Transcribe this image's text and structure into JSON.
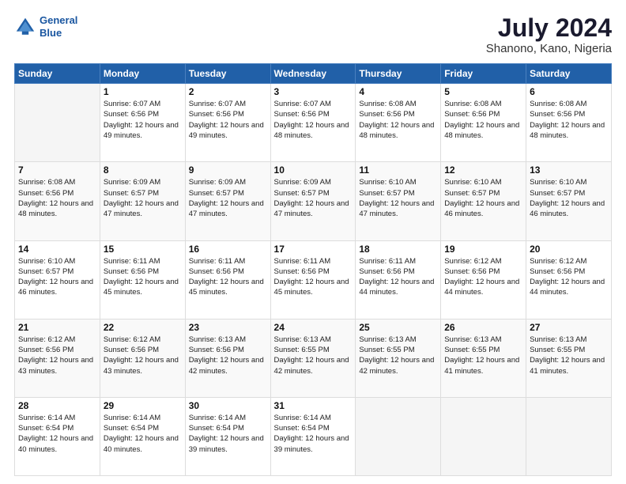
{
  "header": {
    "logo_line1": "General",
    "logo_line2": "Blue",
    "month": "July 2024",
    "location": "Shanono, Kano, Nigeria"
  },
  "days_of_week": [
    "Sunday",
    "Monday",
    "Tuesday",
    "Wednesday",
    "Thursday",
    "Friday",
    "Saturday"
  ],
  "weeks": [
    [
      {
        "day": "",
        "info": ""
      },
      {
        "day": "1",
        "info": "Sunrise: 6:07 AM\nSunset: 6:56 PM\nDaylight: 12 hours\nand 49 minutes."
      },
      {
        "day": "2",
        "info": "Sunrise: 6:07 AM\nSunset: 6:56 PM\nDaylight: 12 hours\nand 49 minutes."
      },
      {
        "day": "3",
        "info": "Sunrise: 6:07 AM\nSunset: 6:56 PM\nDaylight: 12 hours\nand 48 minutes."
      },
      {
        "day": "4",
        "info": "Sunrise: 6:08 AM\nSunset: 6:56 PM\nDaylight: 12 hours\nand 48 minutes."
      },
      {
        "day": "5",
        "info": "Sunrise: 6:08 AM\nSunset: 6:56 PM\nDaylight: 12 hours\nand 48 minutes."
      },
      {
        "day": "6",
        "info": "Sunrise: 6:08 AM\nSunset: 6:56 PM\nDaylight: 12 hours\nand 48 minutes."
      }
    ],
    [
      {
        "day": "7",
        "info": "Sunrise: 6:08 AM\nSunset: 6:56 PM\nDaylight: 12 hours\nand 48 minutes."
      },
      {
        "day": "8",
        "info": "Sunrise: 6:09 AM\nSunset: 6:57 PM\nDaylight: 12 hours\nand 47 minutes."
      },
      {
        "day": "9",
        "info": "Sunrise: 6:09 AM\nSunset: 6:57 PM\nDaylight: 12 hours\nand 47 minutes."
      },
      {
        "day": "10",
        "info": "Sunrise: 6:09 AM\nSunset: 6:57 PM\nDaylight: 12 hours\nand 47 minutes."
      },
      {
        "day": "11",
        "info": "Sunrise: 6:10 AM\nSunset: 6:57 PM\nDaylight: 12 hours\nand 47 minutes."
      },
      {
        "day": "12",
        "info": "Sunrise: 6:10 AM\nSunset: 6:57 PM\nDaylight: 12 hours\nand 46 minutes."
      },
      {
        "day": "13",
        "info": "Sunrise: 6:10 AM\nSunset: 6:57 PM\nDaylight: 12 hours\nand 46 minutes."
      }
    ],
    [
      {
        "day": "14",
        "info": "Sunrise: 6:10 AM\nSunset: 6:57 PM\nDaylight: 12 hours\nand 46 minutes."
      },
      {
        "day": "15",
        "info": "Sunrise: 6:11 AM\nSunset: 6:56 PM\nDaylight: 12 hours\nand 45 minutes."
      },
      {
        "day": "16",
        "info": "Sunrise: 6:11 AM\nSunset: 6:56 PM\nDaylight: 12 hours\nand 45 minutes."
      },
      {
        "day": "17",
        "info": "Sunrise: 6:11 AM\nSunset: 6:56 PM\nDaylight: 12 hours\nand 45 minutes."
      },
      {
        "day": "18",
        "info": "Sunrise: 6:11 AM\nSunset: 6:56 PM\nDaylight: 12 hours\nand 44 minutes."
      },
      {
        "day": "19",
        "info": "Sunrise: 6:12 AM\nSunset: 6:56 PM\nDaylight: 12 hours\nand 44 minutes."
      },
      {
        "day": "20",
        "info": "Sunrise: 6:12 AM\nSunset: 6:56 PM\nDaylight: 12 hours\nand 44 minutes."
      }
    ],
    [
      {
        "day": "21",
        "info": "Sunrise: 6:12 AM\nSunset: 6:56 PM\nDaylight: 12 hours\nand 43 minutes."
      },
      {
        "day": "22",
        "info": "Sunrise: 6:12 AM\nSunset: 6:56 PM\nDaylight: 12 hours\nand 43 minutes."
      },
      {
        "day": "23",
        "info": "Sunrise: 6:13 AM\nSunset: 6:56 PM\nDaylight: 12 hours\nand 42 minutes."
      },
      {
        "day": "24",
        "info": "Sunrise: 6:13 AM\nSunset: 6:55 PM\nDaylight: 12 hours\nand 42 minutes."
      },
      {
        "day": "25",
        "info": "Sunrise: 6:13 AM\nSunset: 6:55 PM\nDaylight: 12 hours\nand 42 minutes."
      },
      {
        "day": "26",
        "info": "Sunrise: 6:13 AM\nSunset: 6:55 PM\nDaylight: 12 hours\nand 41 minutes."
      },
      {
        "day": "27",
        "info": "Sunrise: 6:13 AM\nSunset: 6:55 PM\nDaylight: 12 hours\nand 41 minutes."
      }
    ],
    [
      {
        "day": "28",
        "info": "Sunrise: 6:14 AM\nSunset: 6:54 PM\nDaylight: 12 hours\nand 40 minutes."
      },
      {
        "day": "29",
        "info": "Sunrise: 6:14 AM\nSunset: 6:54 PM\nDaylight: 12 hours\nand 40 minutes."
      },
      {
        "day": "30",
        "info": "Sunrise: 6:14 AM\nSunset: 6:54 PM\nDaylight: 12 hours\nand 39 minutes."
      },
      {
        "day": "31",
        "info": "Sunrise: 6:14 AM\nSunset: 6:54 PM\nDaylight: 12 hours\nand 39 minutes."
      },
      {
        "day": "",
        "info": ""
      },
      {
        "day": "",
        "info": ""
      },
      {
        "day": "",
        "info": ""
      }
    ]
  ]
}
